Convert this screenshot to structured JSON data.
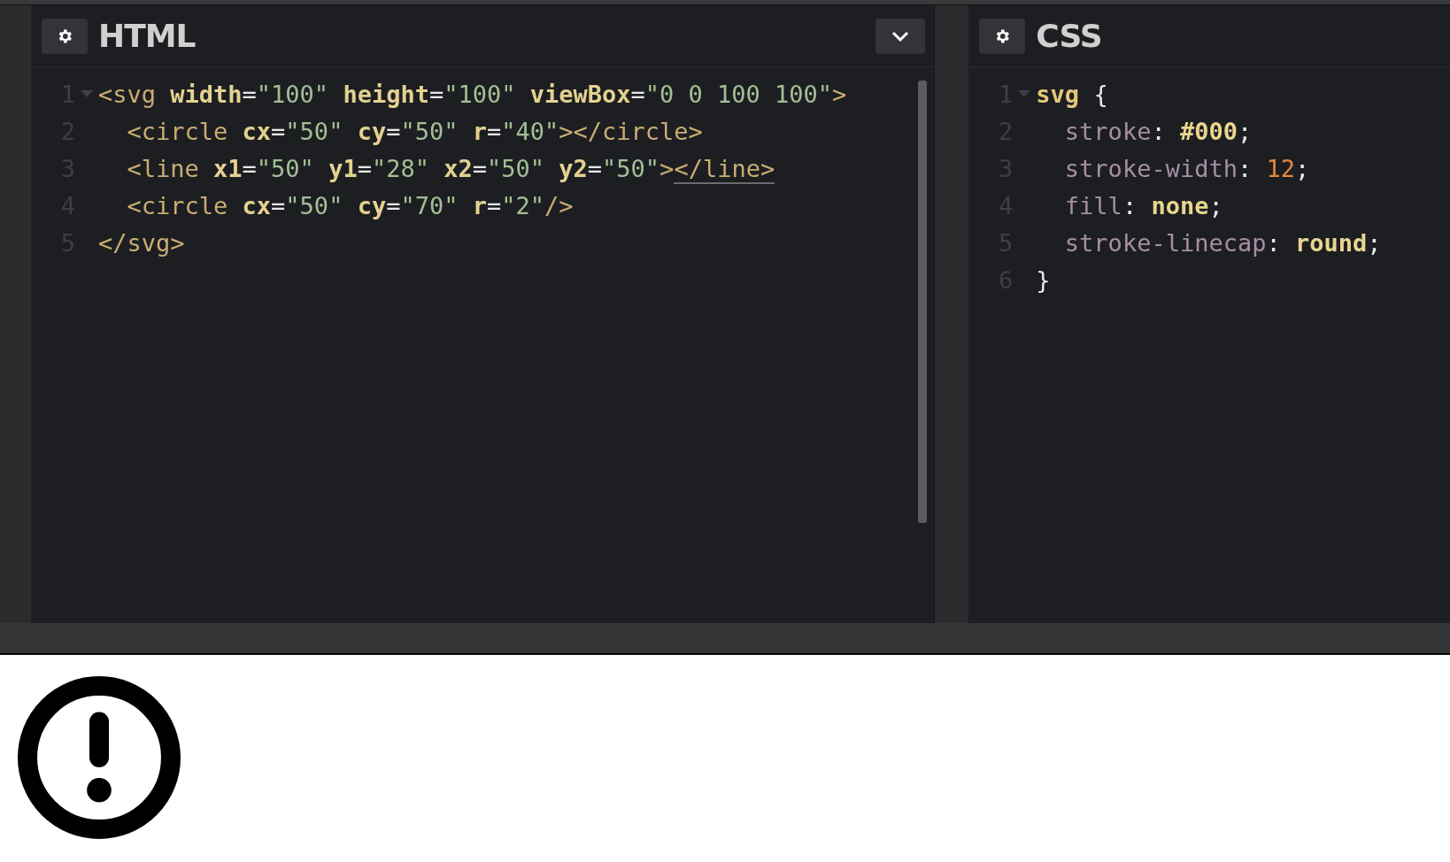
{
  "editors": [
    {
      "title": "HTML",
      "has_collapse": true,
      "scrollbar": true,
      "lines": [
        {
          "number": "1",
          "foldable": true,
          "tokens": [
            {
              "kind": "tag",
              "text": "<svg"
            },
            {
              "kind": "attr",
              "text": " width"
            },
            {
              "kind": "punct",
              "text": "="
            },
            {
              "kind": "value",
              "text": "\"100\""
            },
            {
              "kind": "attr",
              "text": " height"
            },
            {
              "kind": "punct",
              "text": "="
            },
            {
              "kind": "value",
              "text": "\"100\""
            },
            {
              "kind": "attr",
              "text": " viewBox"
            },
            {
              "kind": "punct",
              "text": "="
            },
            {
              "kind": "value",
              "text": "\"0 0 100 100\""
            },
            {
              "kind": "tag",
              "text": ">"
            }
          ]
        },
        {
          "number": "2",
          "foldable": false,
          "tokens": [
            {
              "kind": "tag",
              "text": "  <circle"
            },
            {
              "kind": "attr",
              "text": " cx"
            },
            {
              "kind": "punct",
              "text": "="
            },
            {
              "kind": "value",
              "text": "\"50\""
            },
            {
              "kind": "attr",
              "text": " cy"
            },
            {
              "kind": "punct",
              "text": "="
            },
            {
              "kind": "value",
              "text": "\"50\""
            },
            {
              "kind": "attr",
              "text": " r"
            },
            {
              "kind": "punct",
              "text": "="
            },
            {
              "kind": "value",
              "text": "\"40\""
            },
            {
              "kind": "tag",
              "text": "></circle>"
            }
          ]
        },
        {
          "number": "3",
          "foldable": false,
          "tokens": [
            {
              "kind": "tag",
              "text": "  <line"
            },
            {
              "kind": "attr",
              "text": " x1"
            },
            {
              "kind": "punct",
              "text": "="
            },
            {
              "kind": "value",
              "text": "\"50\""
            },
            {
              "kind": "attr",
              "text": " y1"
            },
            {
              "kind": "punct",
              "text": "="
            },
            {
              "kind": "value",
              "text": "\"28\""
            },
            {
              "kind": "attr",
              "text": " x2"
            },
            {
              "kind": "punct",
              "text": "="
            },
            {
              "kind": "value",
              "text": "\"50\""
            },
            {
              "kind": "attr",
              "text": " y2"
            },
            {
              "kind": "punct",
              "text": "="
            },
            {
              "kind": "value",
              "text": "\"50\""
            },
            {
              "kind": "tag",
              "text": ">"
            },
            {
              "kind": "tag",
              "text": "</line>",
              "underlined": true
            }
          ]
        },
        {
          "number": "4",
          "foldable": false,
          "tokens": [
            {
              "kind": "tag",
              "text": "  <circle"
            },
            {
              "kind": "attr",
              "text": " cx"
            },
            {
              "kind": "punct",
              "text": "="
            },
            {
              "kind": "value",
              "text": "\"50\""
            },
            {
              "kind": "attr",
              "text": " cy"
            },
            {
              "kind": "punct",
              "text": "="
            },
            {
              "kind": "value",
              "text": "\"70\""
            },
            {
              "kind": "attr",
              "text": " r"
            },
            {
              "kind": "punct",
              "text": "="
            },
            {
              "kind": "value",
              "text": "\"2\""
            },
            {
              "kind": "tag",
              "text": "/>"
            }
          ]
        },
        {
          "number": "5",
          "foldable": false,
          "tokens": [
            {
              "kind": "tag",
              "text": "</svg>"
            }
          ]
        }
      ]
    },
    {
      "title": "CSS",
      "has_collapse": false,
      "scrollbar": false,
      "lines": [
        {
          "number": "1",
          "foldable": true,
          "tokens": [
            {
              "kind": "selector",
              "text": "svg"
            },
            {
              "kind": "punct",
              "text": " {"
            }
          ]
        },
        {
          "number": "2",
          "foldable": false,
          "tokens": [
            {
              "kind": "property",
              "text": "  stroke"
            },
            {
              "kind": "punct",
              "text": ": "
            },
            {
              "kind": "keyword",
              "text": "#000"
            },
            {
              "kind": "punct",
              "text": ";"
            }
          ]
        },
        {
          "number": "3",
          "foldable": false,
          "tokens": [
            {
              "kind": "property",
              "text": "  stroke-width"
            },
            {
              "kind": "punct",
              "text": ": "
            },
            {
              "kind": "number",
              "text": "12"
            },
            {
              "kind": "punct",
              "text": ";"
            }
          ]
        },
        {
          "number": "4",
          "foldable": false,
          "tokens": [
            {
              "kind": "property",
              "text": "  fill"
            },
            {
              "kind": "punct",
              "text": ": "
            },
            {
              "kind": "keyword",
              "text": "none"
            },
            {
              "kind": "punct",
              "text": ";"
            }
          ]
        },
        {
          "number": "5",
          "foldable": false,
          "tokens": [
            {
              "kind": "property",
              "text": "  stroke-linecap"
            },
            {
              "kind": "punct",
              "text": ": "
            },
            {
              "kind": "keyword",
              "text": "round"
            },
            {
              "kind": "punct",
              "text": ";"
            }
          ]
        },
        {
          "number": "6",
          "foldable": false,
          "tokens": [
            {
              "kind": "punct",
              "text": "}"
            }
          ]
        }
      ]
    }
  ]
}
